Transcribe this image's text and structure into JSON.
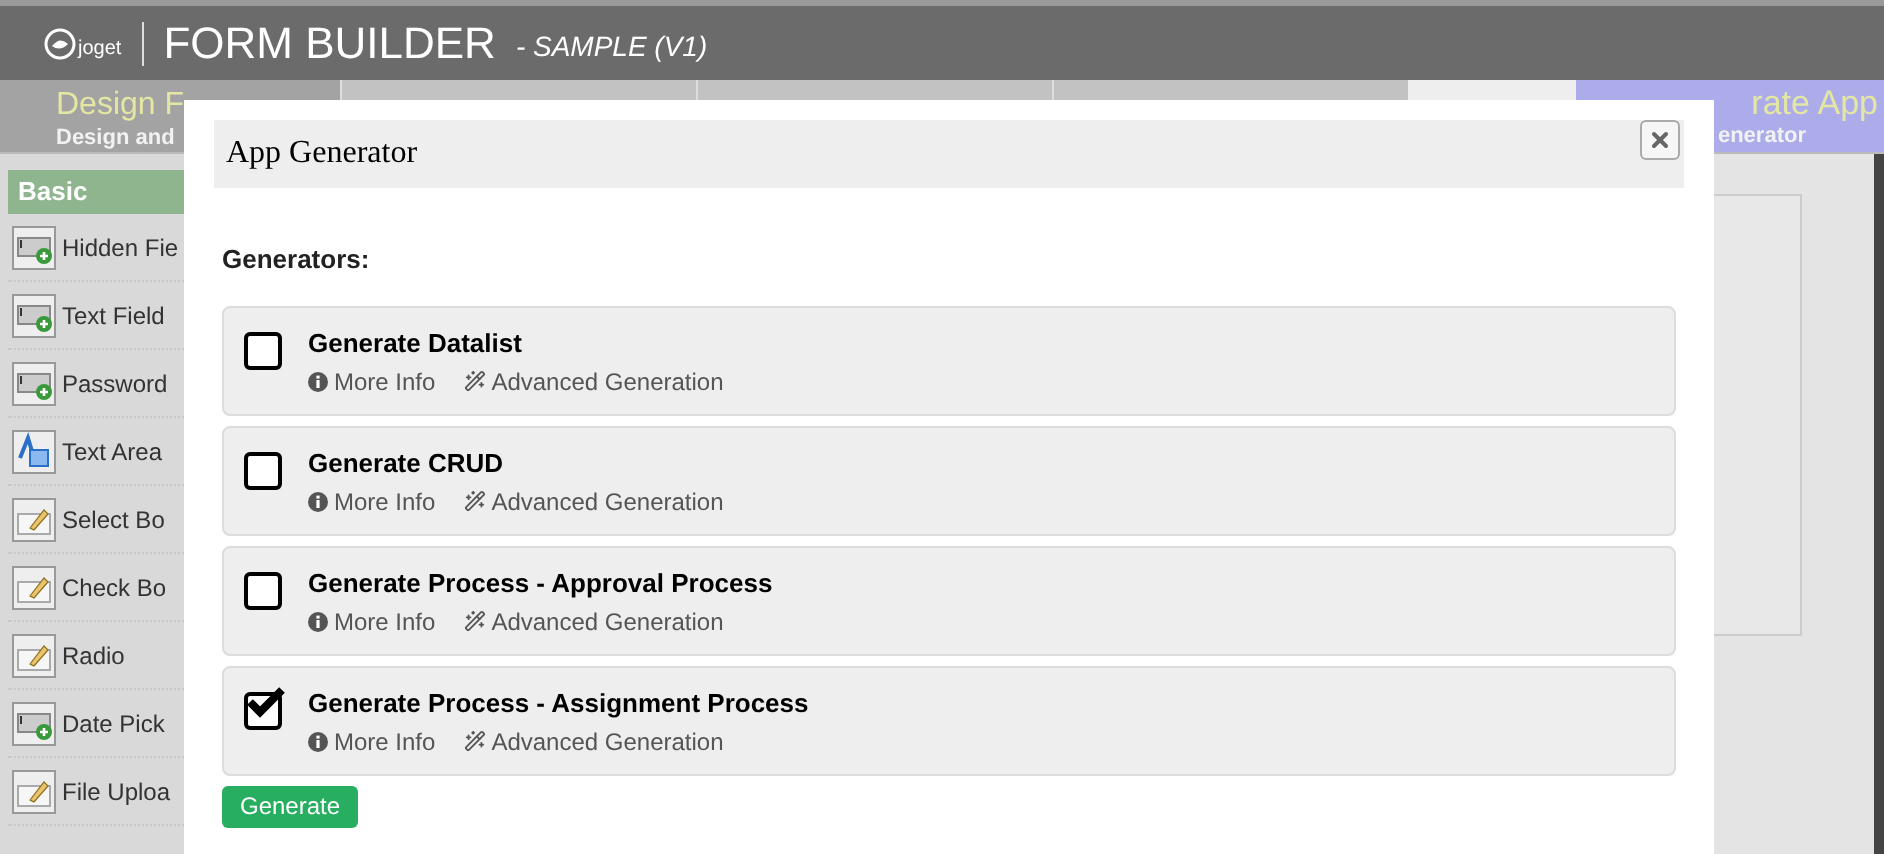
{
  "header": {
    "brand": "joget",
    "title": "FORM BUILDER",
    "subtitle": "- SAMPLE (V1)"
  },
  "steps": [
    {
      "title": "Design F",
      "caption": "Design and",
      "selected": true,
      "kind": "first"
    },
    {
      "kind": "plain",
      "selected": false
    },
    {
      "kind": "plain",
      "selected": false
    },
    {
      "kind": "plain",
      "selected": false
    },
    {
      "kind": "blank",
      "selected": false
    },
    {
      "title": "rate App",
      "caption": "enerator",
      "selected": false,
      "kind": "generate"
    }
  ],
  "palette": {
    "section": "Basic",
    "items": [
      {
        "label": "Hidden Fie",
        "kind": "field"
      },
      {
        "label": "Text Field",
        "kind": "field"
      },
      {
        "label": "Password",
        "kind": "field"
      },
      {
        "label": "Text Area",
        "kind": "textarea"
      },
      {
        "label": "Select Bo",
        "kind": "edit"
      },
      {
        "label": "Check Bo",
        "kind": "edit"
      },
      {
        "label": "Radio",
        "kind": "edit"
      },
      {
        "label": "Date Pick",
        "kind": "field"
      },
      {
        "label": "File Uploa",
        "kind": "edit"
      }
    ]
  },
  "dialog": {
    "title": "App Generator",
    "heading": "Generators:",
    "generators": [
      {
        "name": "Generate Datalist",
        "checked": false,
        "info": "More Info",
        "advanced": "Advanced Generation"
      },
      {
        "name": "Generate CRUD",
        "checked": false,
        "info": "More Info",
        "advanced": "Advanced Generation"
      },
      {
        "name": "Generate Process - Approval Process",
        "checked": false,
        "info": "More Info",
        "advanced": "Advanced Generation"
      },
      {
        "name": "Generate Process - Assignment Process",
        "checked": true,
        "info": "More Info",
        "advanced": "Advanced Generation"
      }
    ],
    "button": "Generate"
  }
}
